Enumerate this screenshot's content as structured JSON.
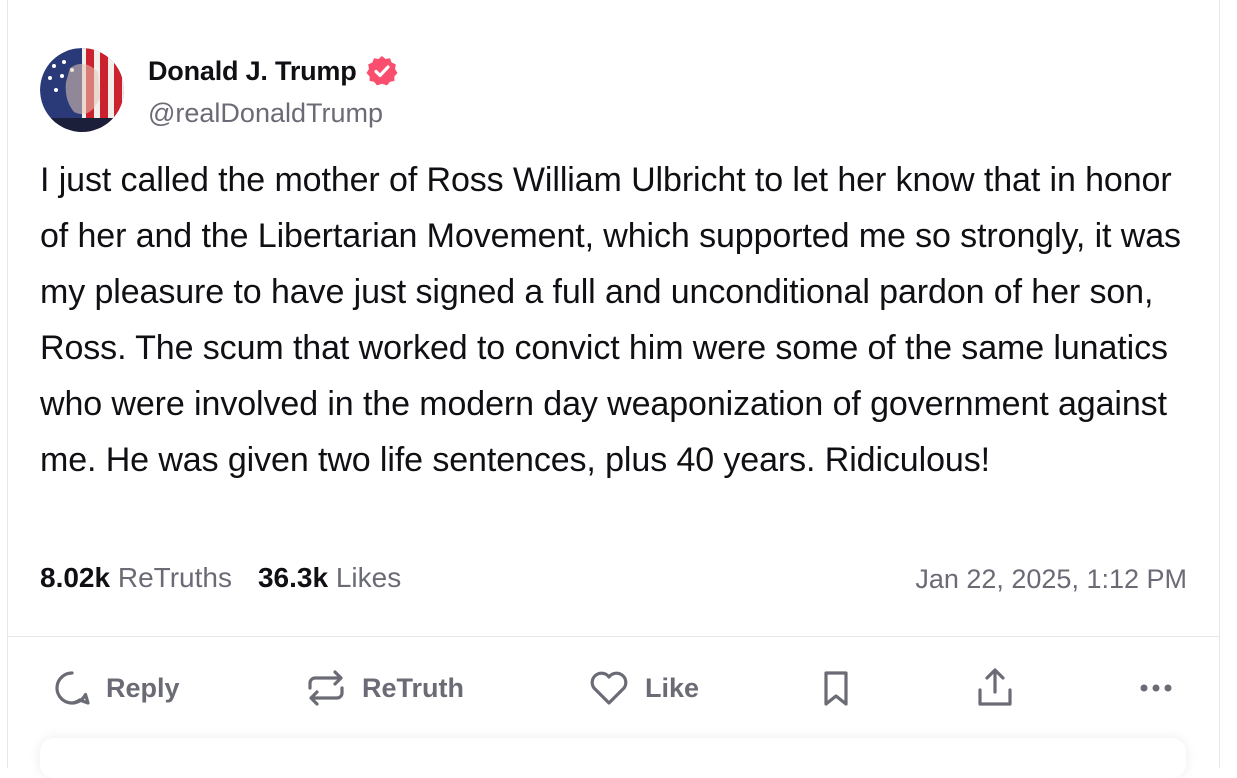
{
  "post": {
    "author_name": "Donald J. Trump",
    "author_handle": "@realDonaldTrump",
    "verified": true,
    "verified_color": "#f94e6d",
    "text": "I just called the mother of Ross William Ulbricht to let her know that in honor of her and the Libertarian Movement, which supported me so strongly, it was my pleasure to have just signed a full and unconditional pardon of her son, Ross. The scum that worked to convict him were some of the same lunatics who were involved in the modern day weaponization of government against me. He was given two life sentences, plus 40 years. Ridiculous!",
    "retruths_count": "8.02k",
    "retruths_label": "ReTruths",
    "likes_count": "36.3k",
    "likes_label": "Likes",
    "timestamp": "Jan 22, 2025, 1:12 PM"
  },
  "actions": {
    "reply_label": "Reply",
    "retruth_label": "ReTruth",
    "like_label": "Like",
    "icons": [
      "reply-icon",
      "retruth-icon",
      "heart-icon",
      "bookmark-icon",
      "share-icon",
      "more-icon"
    ]
  },
  "colors": {
    "text": "#101014",
    "muted": "#6b6b76",
    "divider": "#e6e6ea"
  }
}
